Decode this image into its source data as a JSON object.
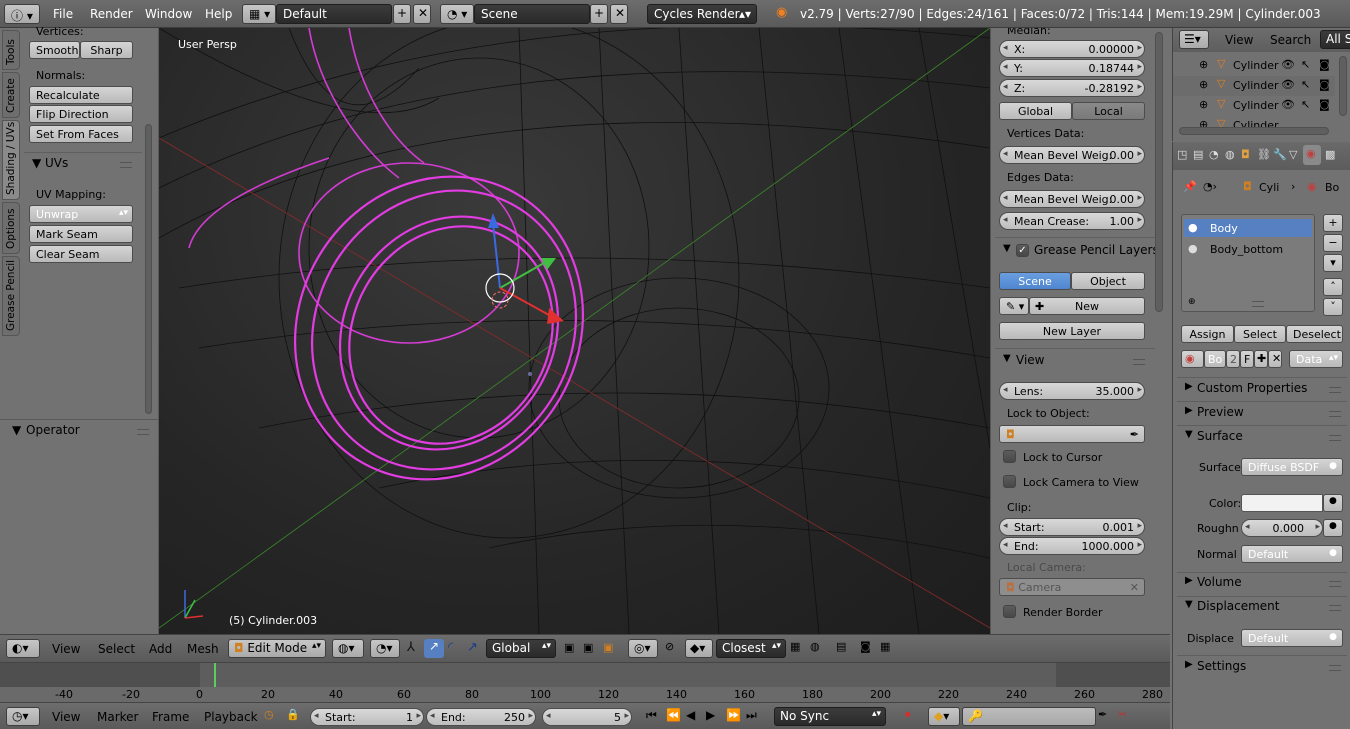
{
  "topbar": {
    "menus": [
      "File",
      "Render",
      "Window",
      "Help"
    ],
    "screen": "Default",
    "scene": "Scene",
    "engine": "Cycles Render",
    "stats": "v2.79 | Verts:27/90 | Edges:24/161 | Faces:0/72 | Tris:144 | Mem:19.29M | Cylinder.003"
  },
  "toolshelf": {
    "tabs": [
      "Tools",
      "Create",
      "Shading / UVs",
      "Options",
      "Grease Pencil"
    ],
    "vertices_label": "Vertices:",
    "smooth": "Smooth",
    "sharp": "Sharp",
    "normals_label": "Normals:",
    "recalculate": "Recalculate",
    "flip_direction": "Flip Direction",
    "set_from_faces": "Set From Faces",
    "uvs_header": "UVs",
    "uv_mapping_label": "UV Mapping:",
    "unwrap": "Unwrap",
    "mark_seam": "Mark Seam",
    "clear_seam": "Clear Seam",
    "operator": "Operator"
  },
  "viewport": {
    "view_label": "User Persp",
    "object_label": "(5) Cylinder.003"
  },
  "npanel": {
    "median": "Median:",
    "x_label": "X:",
    "x": "0.00000",
    "y_label": "Y:",
    "y": "0.18744",
    "z_label": "Z:",
    "z": "-0.28192",
    "global": "Global",
    "local": "Local",
    "vertices_data": "Vertices Data:",
    "mean_bevel_label": "Mean Bevel Weig:",
    "mean_bevel_v": "0.00",
    "edges_data": "Edges Data:",
    "mean_bevel_e": "0.00",
    "mean_crease_label": "Mean Crease:",
    "mean_crease": "1.00",
    "gp_header": "Grease Pencil Layers",
    "scene": "Scene",
    "object": "Object",
    "new": "New",
    "new_layer": "New Layer",
    "view_header": "View",
    "lens_label": "Lens:",
    "lens": "35.000",
    "lock_to_object": "Lock to Object:",
    "lock_to_cursor": "Lock to Cursor",
    "lock_camera": "Lock Camera to View",
    "clip": "Clip:",
    "start_label": "Start:",
    "start": "0.001",
    "end_label": "End:",
    "end": "1000.000",
    "local_camera": "Local Camera:",
    "camera": "Camera",
    "render_border": "Render Border"
  },
  "outliner": {
    "view": "View",
    "search": "Search",
    "all_scenes": "All Sc",
    "rows": [
      "Cylinder",
      "Cylinder",
      "Cylinder",
      "Cylinder"
    ]
  },
  "properties": {
    "crumb_obj": "Cyli",
    "crumb_mat": "Bo",
    "materials": [
      "Body",
      "Body_bottom"
    ],
    "assign": "Assign",
    "select": "Select",
    "deselect": "Deselect",
    "mat_name": "Bo",
    "users": "2",
    "fake": "F",
    "data": "Data",
    "custom_properties": "Custom Properties",
    "preview": "Preview",
    "surface_header": "Surface",
    "surface_label": "Surface:",
    "surface_value": "Diffuse BSDF",
    "color_label": "Color:",
    "rough_label": "Roughn",
    "rough_value": "0.000",
    "normal_label": "Normal",
    "normal_value": "Default",
    "volume": "Volume",
    "displacement": "Displacement",
    "displace_label": "Displace",
    "displace_value": "Default",
    "settings": "Settings"
  },
  "viewheader": {
    "view": "View",
    "select": "Select",
    "add": "Add",
    "mesh": "Mesh",
    "mode": "Edit Mode",
    "orientation": "Global",
    "snap": "Closest"
  },
  "timeline": {
    "ticks": [
      "-40",
      "-20",
      "0",
      "20",
      "40",
      "60",
      "80",
      "100",
      "120",
      "140",
      "160",
      "180",
      "200",
      "220",
      "240",
      "260",
      "280"
    ],
    "view": "View",
    "marker": "Marker",
    "frame": "Frame",
    "playback": "Playback",
    "start_label": "Start:",
    "start": "1",
    "end_label": "End:",
    "end": "250",
    "current": "5",
    "sync": "No Sync"
  },
  "colors": {
    "select": "#e040e0",
    "accent": "#5680c2"
  }
}
